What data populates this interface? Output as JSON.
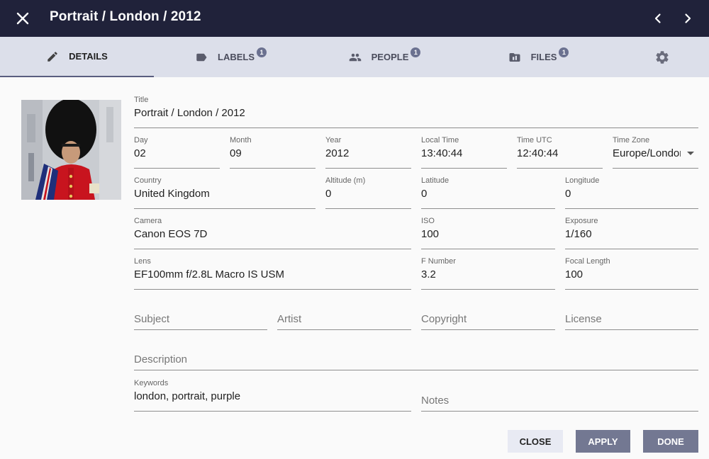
{
  "header": {
    "title": "Portrait / London / 2012"
  },
  "tabs": [
    {
      "label": "Details",
      "icon": "pencil-icon",
      "badge": ""
    },
    {
      "label": "Labels",
      "icon": "label-icon",
      "badge": "1"
    },
    {
      "label": "People",
      "icon": "people-icon",
      "badge": "1"
    },
    {
      "label": "Files",
      "icon": "folder-icon",
      "badge": "1"
    }
  ],
  "fields": {
    "title": {
      "label": "Title",
      "value": "Portrait / London / 2012"
    },
    "day": {
      "label": "Day",
      "value": "02"
    },
    "month": {
      "label": "Month",
      "value": "09"
    },
    "year": {
      "label": "Year",
      "value": "2012"
    },
    "local_time": {
      "label": "Local Time",
      "value": "13:40:44"
    },
    "time_utc": {
      "label": "Time UTC",
      "value": "12:40:44"
    },
    "time_zone": {
      "label": "Time Zone",
      "value": "Europe/London"
    },
    "country": {
      "label": "Country",
      "value": "United Kingdom"
    },
    "altitude": {
      "label": "Altitude (m)",
      "value": "0"
    },
    "latitude": {
      "label": "Latitude",
      "value": "0"
    },
    "longitude": {
      "label": "Longitude",
      "value": "0"
    },
    "camera": {
      "label": "Camera",
      "value": "Canon EOS 7D"
    },
    "iso": {
      "label": "ISO",
      "value": "100"
    },
    "exposure": {
      "label": "Exposure",
      "value": "1/160"
    },
    "lens": {
      "label": "Lens",
      "value": "EF100mm f/2.8L Macro IS USM"
    },
    "f_number": {
      "label": "F Number",
      "value": "3.2"
    },
    "focal_length": {
      "label": "Focal Length",
      "value": "100"
    },
    "subject": {
      "placeholder": "Subject"
    },
    "artist": {
      "placeholder": "Artist"
    },
    "copyright": {
      "placeholder": "Copyright"
    },
    "license": {
      "placeholder": "License"
    },
    "description": {
      "placeholder": "Description"
    },
    "keywords": {
      "label": "Keywords",
      "value": "london, portrait, purple"
    },
    "notes": {
      "placeholder": "Notes"
    }
  },
  "buttons": {
    "close": "Close",
    "apply": "Apply",
    "done": "Done"
  },
  "colors": {
    "header_bg": "#20223a",
    "tabs_bg": "#dcdfea",
    "badge": "#6b7190",
    "primary_button": "#737892"
  }
}
